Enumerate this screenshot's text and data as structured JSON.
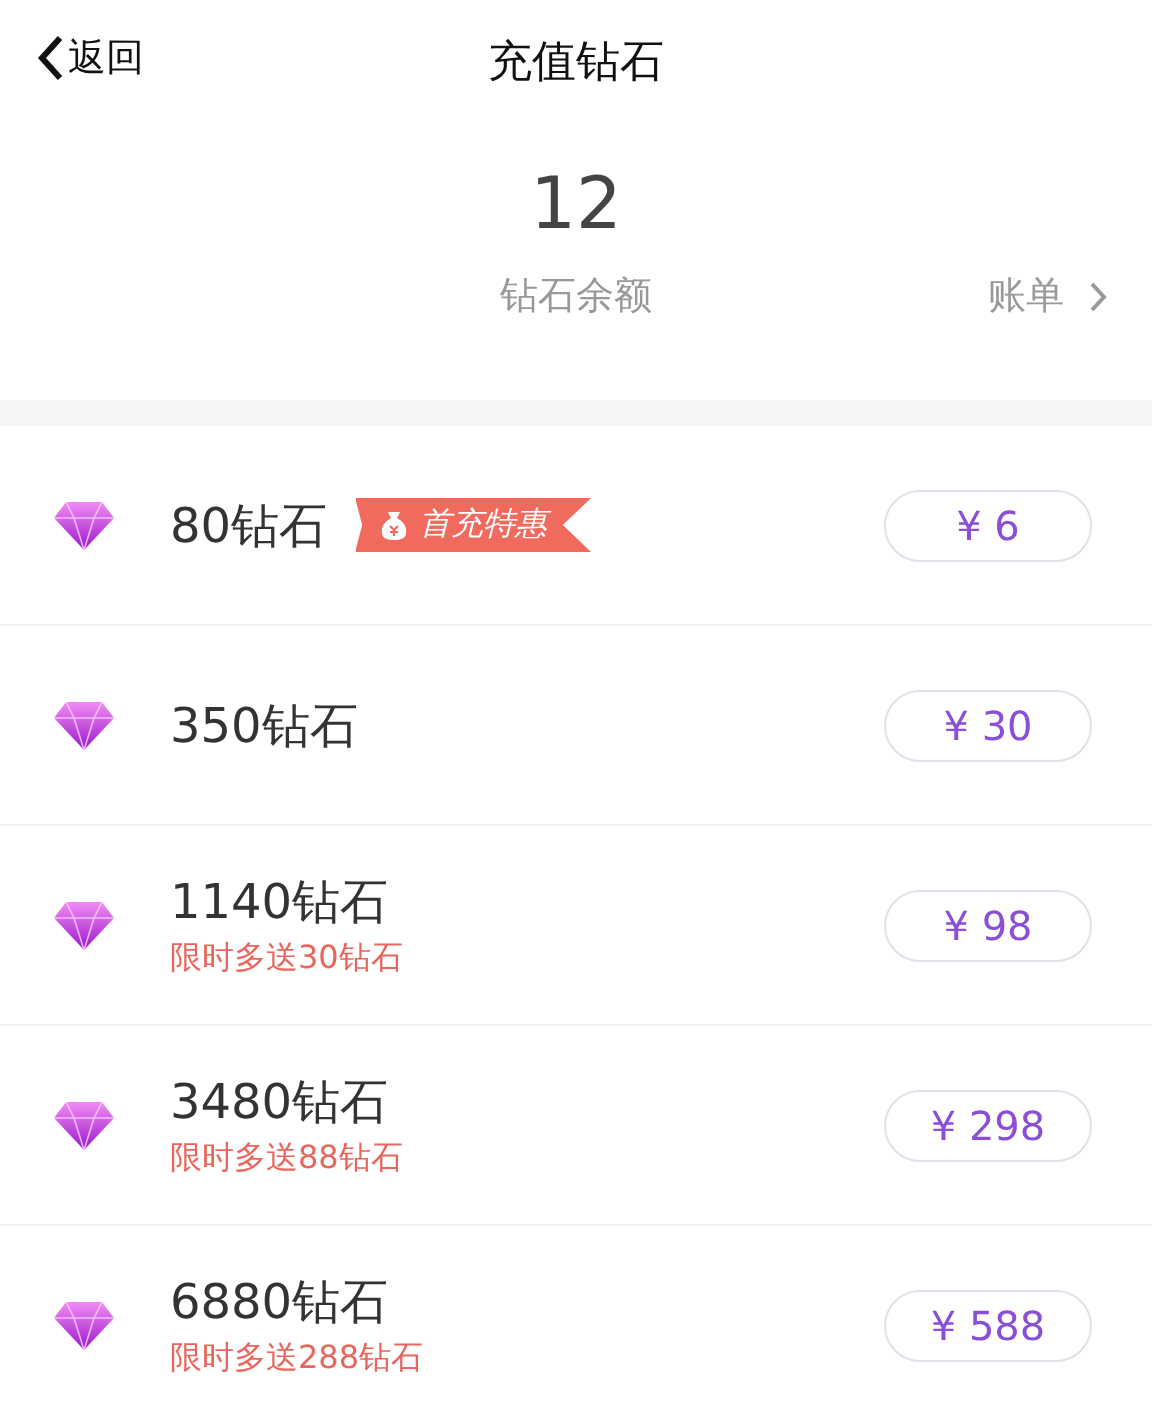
{
  "nav": {
    "back_label": "返回",
    "title": "充值钻石"
  },
  "balance": {
    "amount": "12",
    "label": "钻石余额",
    "bill_link": "账单"
  },
  "packages": [
    {
      "name": "80钻石",
      "badge": "首充特惠",
      "price": "¥ 6"
    },
    {
      "name": "350钻石",
      "price": "¥ 30"
    },
    {
      "name": "1140钻石",
      "bonus": "限时多送30钻石",
      "price": "¥ 98"
    },
    {
      "name": "3480钻石",
      "bonus": "限时多送88钻石",
      "price": "¥ 298"
    },
    {
      "name": "6880钻石",
      "bonus": "限时多送288钻石",
      "price": "¥ 588"
    }
  ]
}
